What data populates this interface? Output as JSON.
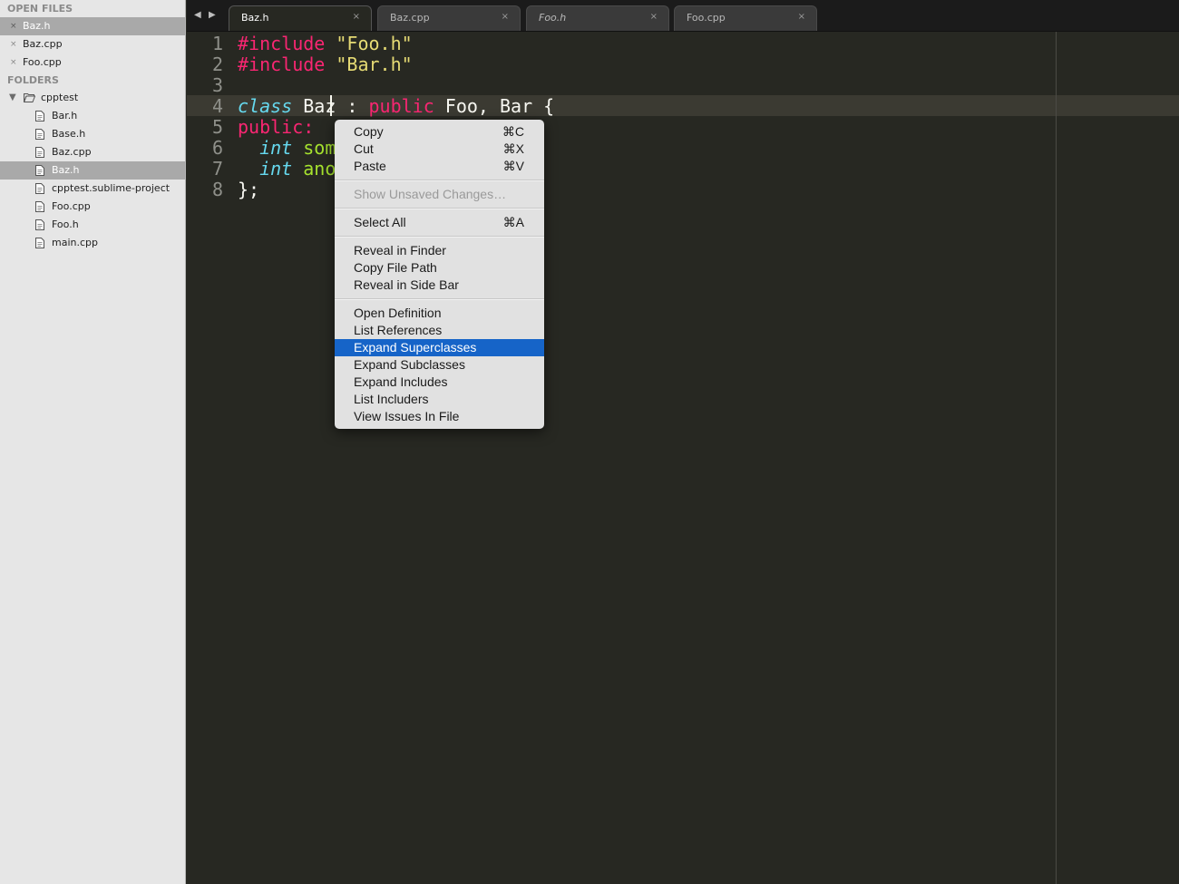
{
  "sidebar": {
    "open_files_heading": "OPEN FILES",
    "open_files": [
      {
        "label": "Baz.h",
        "selected": true
      },
      {
        "label": "Baz.cpp",
        "selected": false
      },
      {
        "label": "Foo.cpp",
        "selected": false
      }
    ],
    "close_glyph": "×",
    "folders_heading": "FOLDERS",
    "folder": {
      "label": "cpptest",
      "expanded_glyph": "▼"
    },
    "files": [
      {
        "label": "Bar.h"
      },
      {
        "label": "Base.h"
      },
      {
        "label": "Baz.cpp"
      },
      {
        "label": "Baz.h",
        "selected": true
      },
      {
        "label": "cpptest.sublime-project"
      },
      {
        "label": "Foo.cpp"
      },
      {
        "label": "Foo.h"
      },
      {
        "label": "main.cpp"
      }
    ]
  },
  "tabbar": {
    "back_arrow": "◀",
    "forward_arrow": "▶",
    "close_glyph": "×",
    "tabs": [
      {
        "label": "Baz.h",
        "active": true
      },
      {
        "label": "Baz.cpp"
      },
      {
        "label": "Foo.h",
        "italic": true
      },
      {
        "label": "Foo.cpp"
      }
    ]
  },
  "editor": {
    "line_numbers": [
      "1",
      "2",
      "3",
      "4",
      "5",
      "6",
      "7",
      "8"
    ],
    "current_line": 4,
    "code": {
      "l1": {
        "kw": "#include",
        "sp": " ",
        "str": "\"Foo.h\""
      },
      "l2": {
        "kw": "#include",
        "sp": " ",
        "str": "\"Bar.h\""
      },
      "l4": {
        "type": "class",
        "sp1": " ",
        "name": "Baz",
        "p1": " : ",
        "kw": "public",
        "rest": " Foo, Bar {"
      },
      "l5": {
        "kw": "public:"
      },
      "l6": {
        "indent": "  ",
        "type": "int",
        "sp": " ",
        "name": "some"
      },
      "l7": {
        "indent": "  ",
        "type": "int",
        "sp": " ",
        "name": "anot"
      },
      "l8": {
        "text": "};"
      }
    }
  },
  "context_menu": {
    "copy": {
      "label": "Copy",
      "shortcut": "⌘C"
    },
    "cut": {
      "label": "Cut",
      "shortcut": "⌘X"
    },
    "paste": {
      "label": "Paste",
      "shortcut": "⌘V"
    },
    "show_unsaved": {
      "label": "Show Unsaved Changes…"
    },
    "select_all": {
      "label": "Select All",
      "shortcut": "⌘A"
    },
    "reveal_finder": {
      "label": "Reveal in Finder"
    },
    "copy_path": {
      "label": "Copy File Path"
    },
    "reveal_sidebar": {
      "label": "Reveal in Side Bar"
    },
    "open_definition": {
      "label": "Open Definition"
    },
    "list_references": {
      "label": "List References"
    },
    "expand_superclasses": {
      "label": "Expand Superclasses",
      "highlighted": true
    },
    "expand_subclasses": {
      "label": "Expand Subclasses"
    },
    "expand_includes": {
      "label": "Expand Includes"
    },
    "list_includers": {
      "label": "List Includers"
    },
    "view_issues": {
      "label": "View Issues In File"
    }
  },
  "colors": {
    "editor_bg": "#272822",
    "keyword": "#f92672",
    "string": "#e6db74",
    "type": "#66d9ef",
    "name": "#a6e22e",
    "menu_highlight": "#1664c8",
    "sidebar_bg": "#e6e6e6"
  }
}
